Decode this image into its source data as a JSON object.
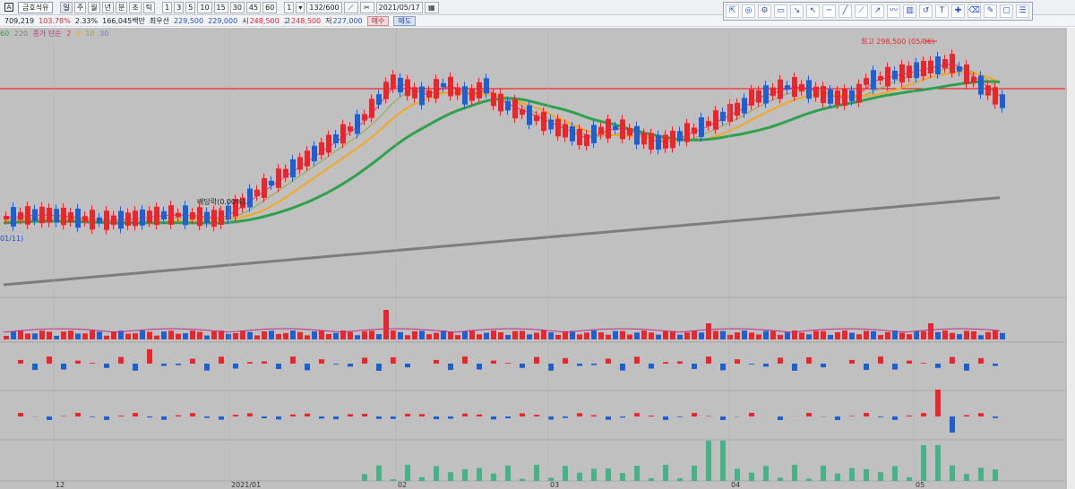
{
  "toolbar": {
    "code_icon": "A",
    "stock_name": "금호석유",
    "periods": [
      "일",
      "주",
      "월",
      "년",
      "분",
      "초",
      "틱"
    ],
    "minutes": [
      "1",
      "3",
      "5",
      "10",
      "15",
      "30",
      "45",
      "60"
    ],
    "step_value": "1",
    "count_value": "132/600",
    "date_value": "2021/05/17"
  },
  "info": {
    "volume": "709,219",
    "change": "103.78%",
    "change_rate": "2.33%",
    "turnover": "166,045백만",
    "best_label": "최우선",
    "ask": "229,500",
    "bid": "229,000",
    "open_label": "시",
    "open": "248,500",
    "high_label": "고",
    "high": "248,500",
    "low_label": "저",
    "low": "227,000",
    "buy_label": "매수",
    "sell_label": "매도"
  },
  "legend": {
    "ma_long": "60",
    "ma_vlong": "220",
    "ma_label": "종가 단순",
    "ma_periods": [
      "2",
      "5",
      "10",
      "30"
    ]
  },
  "annotations": {
    "dividend": "배당락(0.00%)",
    "high_mark": "최고 298,500 (05/06)",
    "left_cut": "01/11)"
  },
  "dates": [
    "12",
    "2021/01",
    "02",
    "03",
    "04",
    "05"
  ],
  "colors": {
    "up": "#e8262e",
    "down": "#1f60d0",
    "ma5": "#ff2a6d",
    "ma10": "#f4a720",
    "ma20": "#2fa04c",
    "ma_vlong": "#7d7d7d",
    "background": "#c0c0c0",
    "volume_pos": "#45b28a"
  },
  "chart_data": {
    "type": "candlestick",
    "note_period": "daily",
    "reference_line": 248500,
    "high_marker": {
      "date": "05/06",
      "value": 298500
    }
  },
  "drawing_tools": [
    "cursor-icon",
    "fibonacci-icon",
    "settings-icon",
    "text-box-icon",
    "trend-down-icon",
    "arrow-icon",
    "horizontal-line-icon",
    "line-icon",
    "trend-line-icon",
    "ray-icon",
    "wave-icon",
    "candle-icon",
    "return-icon",
    "text-icon",
    "cross-icon",
    "eraser-icon",
    "pen-icon",
    "window-icon",
    "list-icon"
  ]
}
